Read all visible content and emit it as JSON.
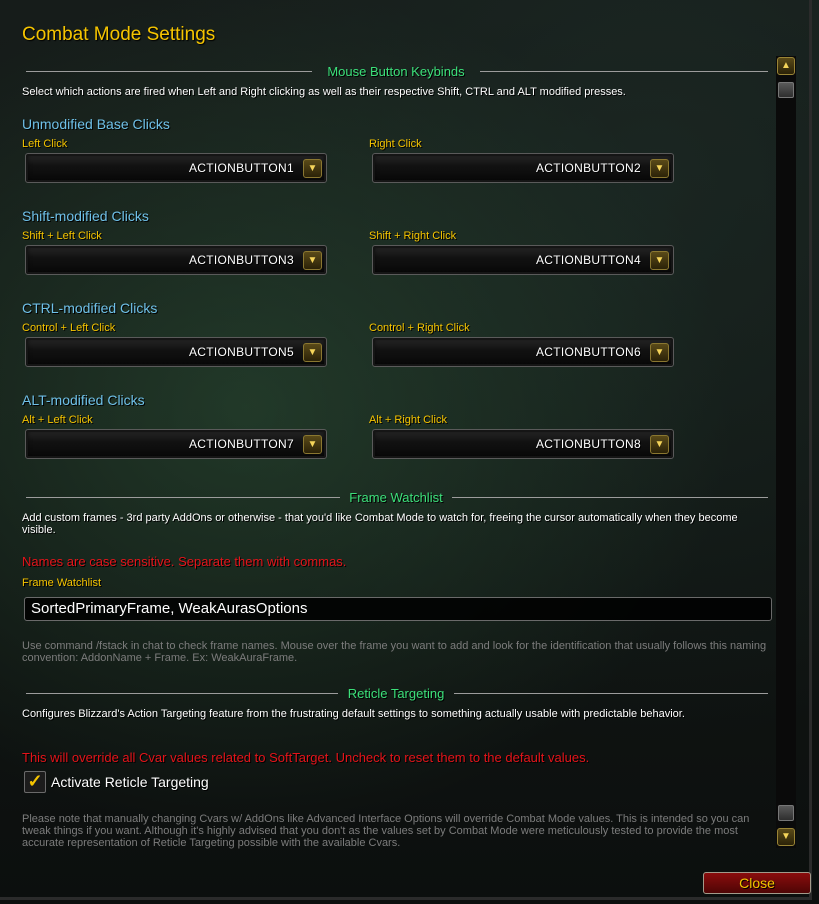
{
  "window": {
    "title": "Combat Mode Settings"
  },
  "mouse_section": {
    "title": "Mouse Button Keybinds",
    "description": "Select which actions are fired when Left and Right clicking as well as their respective Shift, CTRL and ALT modified presses.",
    "groups": [
      {
        "heading": "Unmodified Base Clicks",
        "left": {
          "label": "Left Click",
          "value": "ACTIONBUTTON1"
        },
        "right": {
          "label": "Right Click",
          "value": "ACTIONBUTTON2"
        }
      },
      {
        "heading": "Shift-modified Clicks",
        "left": {
          "label": "Shift + Left Click",
          "value": "ACTIONBUTTON3"
        },
        "right": {
          "label": "Shift + Right Click",
          "value": "ACTIONBUTTON4"
        }
      },
      {
        "heading": "CTRL-modified Clicks",
        "left": {
          "label": "Control + Left Click",
          "value": "ACTIONBUTTON5"
        },
        "right": {
          "label": "Control + Right Click",
          "value": "ACTIONBUTTON6"
        }
      },
      {
        "heading": "ALT-modified Clicks",
        "left": {
          "label": "Alt + Left Click",
          "value": "ACTIONBUTTON7"
        },
        "right": {
          "label": "Alt + Right Click",
          "value": "ACTIONBUTTON8"
        }
      }
    ]
  },
  "watchlist_section": {
    "title": "Frame Watchlist",
    "description": "Add custom frames - 3rd party AddOns or otherwise - that you'd like Combat Mode to watch for, freeing the cursor automatically when they become visible.",
    "warning": "Names are case sensitive. Separate them with commas.",
    "field_label": "Frame Watchlist",
    "field_value": "SortedPrimaryFrame, WeakAurasOptions",
    "help": "Use command /fstack in chat to check frame names. Mouse over the frame you want to add and look for the identification that usually follows this naming convention: AddonName + Frame. Ex: WeakAuraFrame."
  },
  "reticle_section": {
    "title": "Reticle Targeting",
    "description": "Configures Blizzard's Action Targeting feature from the frustrating default settings to something actually usable with predictable behavior.",
    "warning": "This will override all Cvar values related to SoftTarget. Uncheck to reset them to the default values.",
    "checkbox_label": "Activate Reticle Targeting",
    "checkbox_checked": true,
    "note": "Please note that manually changing Cvars w/ AddOns like Advanced Interface Options will override Combat Mode values. This is intended so you can tweak things if you want. Although it's highly advised that you don't as the values set by Combat Mode were meticulously tested to provide the most accurate representation of Reticle Targeting possible with the available Cvars."
  },
  "footer": {
    "close_label": "Close"
  },
  "icons": {
    "dropdown_arrow": "chevron-down-icon",
    "scroll_up": "scroll-up-icon",
    "scroll_down": "scroll-down-icon",
    "check": "checkmark-icon"
  },
  "colors": {
    "title": "#f5c400",
    "section": "#3ce07a",
    "subhead": "#6fc0e8",
    "warning": "#e4141a",
    "close_bg": "#8a0d0d"
  }
}
